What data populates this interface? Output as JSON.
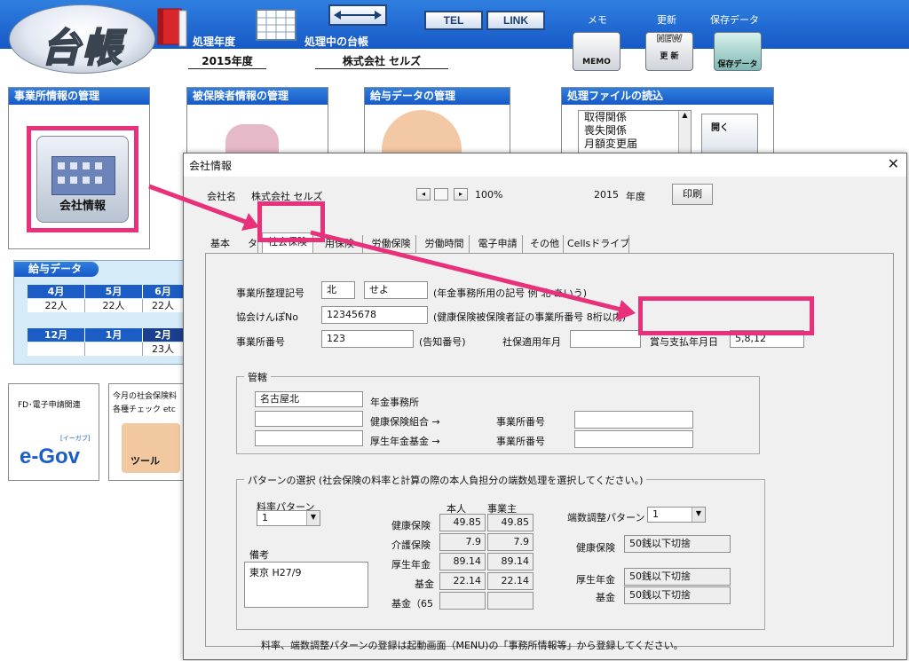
{
  "app": {
    "logo_text": "台帳",
    "processing_year_label": "処理年度",
    "processing_year_value": "2015年度",
    "current_ledger_label": "処理中の台帳",
    "current_ledger_value": "株式会社 セルズ",
    "tel_label": "TEL",
    "link_label": "LINK",
    "memo_caption": "メモ",
    "memo_icon_text": "MEMO",
    "update_caption": "更新",
    "update_icon_text": "更 新",
    "update_icon_new": "NEW",
    "save_caption": "保存データ",
    "save_icon_text": "保存データ"
  },
  "panels": {
    "office_title": "事業所情報の管理",
    "company_button": "会社情報",
    "insured_title": "被保険者情報の管理",
    "salary_mgmt_title": "給与データの管理",
    "file_read_title": "処理ファイルの読込",
    "file_list": [
      "取得関係",
      "喪失関係",
      "月額変更届"
    ],
    "open_label": "開く"
  },
  "salary": {
    "title": "給与データ",
    "row1_months": [
      "4月",
      "5月",
      "6月"
    ],
    "row1_counts": [
      "22人",
      "22人",
      "22人"
    ],
    "row2_months": [
      "12月",
      "1月",
      "2月"
    ],
    "row2_counts": [
      "",
      "",
      "23人"
    ]
  },
  "bottom": {
    "egov_caption": "FD･電子申請関連",
    "egov_logo": "e-Gov",
    "egov_kana": "[イーガブ]",
    "tool_caption1": "今月の社会保険料",
    "tool_caption2": "各種チェック etc",
    "tool_label": "ツール"
  },
  "dialog": {
    "title": "会社情報",
    "close": "✕",
    "company_name_label": "会社名",
    "company_name_value": "株式会社 セルズ",
    "zoom": "100%",
    "year_value": "2015",
    "year_label": "年度",
    "print_button": "印刷",
    "tabs": [
      "基本データ",
      "社会保険",
      "雇用保険",
      "労働保険",
      "労働時間",
      "電子申請",
      "その他",
      "Cellsドライブ"
    ],
    "tab0_visible": "基本",
    "tab0_tail": "タ",
    "tab2_visible": "用保険",
    "office_code_label": "事業所整理記号",
    "office_code_1": "北",
    "office_code_2": "せよ",
    "office_code_note": "(年金事務所用の記号 例 北 あいう)",
    "kyokai_label": "協会けんぽNo",
    "kyokai_value": "12345678",
    "kyokai_note": "(健康保険被保険者証の事業所番号 8桁以内)",
    "office_no_label": "事業所番号",
    "office_no_value": "123",
    "office_no_note": "(告知番号)",
    "apply_label": "社保適用年月",
    "bonus_label": "賞与支払年月日",
    "bonus_value": "5,8,12",
    "jurisdiction": {
      "caption": "管轄",
      "office_value": "名古屋北",
      "pension_office_label": "年金事務所",
      "health_union_label": "健康保険組合 →",
      "pension_fund_label": "厚生年金基金 →",
      "office_number_label": "事業所番号"
    },
    "pattern": {
      "caption": "パターンの選択 (社会保険の料率と計算の際の本人負担分の端数処理を選択してください。)",
      "rate_pattern_label": "料率パターン",
      "rate_pattern_value": "1",
      "col_self": "本人",
      "col_employer": "事業主",
      "rows": [
        {
          "label": "健康保険",
          "self": "49.85",
          "employer": "49.85"
        },
        {
          "label": "介護保険",
          "self": "7.9",
          "employer": "7.9"
        },
        {
          "label": "厚生年金",
          "self": "89.14",
          "employer": "89.14"
        },
        {
          "label": "基金",
          "self": "22.14",
          "employer": "22.14"
        },
        {
          "label": "基金（65",
          "self": "",
          "employer": ""
        }
      ],
      "rounding_label": "端数調整パターン",
      "rounding_value": "1",
      "r_health_label": "健康保険",
      "r_health_value": "50銭以下切捨",
      "r_pension_label": "厚生年金",
      "r_pension_value": "50銭以下切捨",
      "r_fund_label": "基金",
      "r_fund_value": "50銭以下切捨",
      "remarks_label": "備考",
      "remarks_value": "東京 H27/9",
      "footer_note": "料率、端数調整パターンの登録は起動画面（MENU)の「事務所情報等」から登録してください。"
    }
  },
  "colors": {
    "header_blue": "#1a5ec8",
    "highlight_pink": "#e8317a"
  }
}
